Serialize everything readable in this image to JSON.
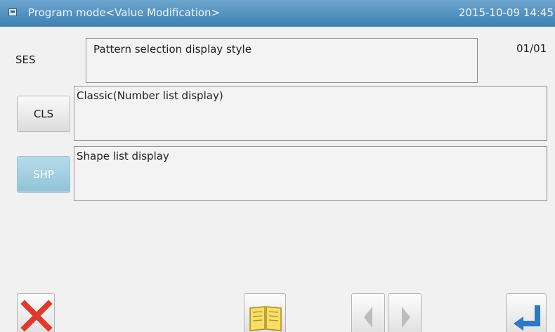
{
  "header": {
    "title": "Program mode<Value Modification>",
    "datetime": "2015-10-09 14:45"
  },
  "parameter": {
    "code": "SES",
    "description": "Pattern selection display style",
    "page": "01/01"
  },
  "options": [
    {
      "code": "CLS",
      "description": "Classic(Number list display)",
      "selected": false
    },
    {
      "code": "SHP",
      "description": "Shape list display",
      "selected": true
    }
  ],
  "colors": {
    "titlebar": "#3d7fb0",
    "selected_button": "#8fc3d8",
    "cancel_red": "#e03a2c",
    "enter_blue": "#2d79c4"
  },
  "toolbar": {
    "icons": [
      "close-icon",
      "book-icon",
      "arrow-left-icon",
      "arrow-right-icon",
      "enter-icon"
    ]
  }
}
